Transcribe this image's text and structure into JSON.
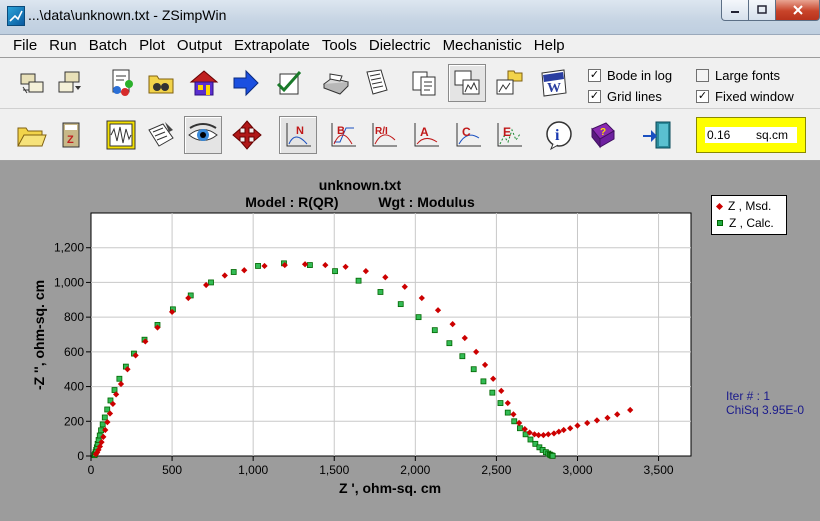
{
  "window": {
    "title": "...\\data\\unknown.txt - ZSimpWin",
    "minimize_icon": "minimize-icon",
    "maximize_icon": "maximize-icon",
    "close_icon": "close-icon"
  },
  "menu": [
    "File",
    "Run",
    "Batch",
    "Plot",
    "Output",
    "Extrapolate",
    "Tools",
    "Dielectric",
    "Mechanistic",
    "Help"
  ],
  "toolbar1": {
    "icons": [
      "open-batch-icon",
      "save-batch-icon",
      "circuit-elements-icon",
      "find-folder-icon",
      "home-icon",
      "next-arrow-icon",
      "checklist-icon",
      "print-icon",
      "report-icon",
      "copy-pages-icon",
      "copy-graph-icon",
      "open-graph-folder-icon",
      "word-export-icon"
    ],
    "checkboxes": [
      {
        "label": "Bode in log",
        "checked": true
      },
      {
        "label": "Grid lines",
        "checked": true
      },
      {
        "label": "Large fonts",
        "checked": false
      },
      {
        "label": "Fixed window",
        "checked": true
      }
    ]
  },
  "toolbar2": {
    "icons": [
      "open-file-icon",
      "calculator-icon",
      "impedance-wave-icon",
      "edit-data-icon",
      "view-eye-icon",
      "move-arrows-icon",
      "nyquist-plot-icon",
      "bode-plot-icon",
      "r-i-plot-icon",
      "admittance-plot-icon",
      "capacitance-plot-icon",
      "modulus-plot-icon",
      "info-icon",
      "help-book-icon",
      "exit-door-icon"
    ],
    "plot_letters": [
      "N",
      "B",
      "R/I",
      "A",
      "C",
      "E"
    ],
    "area_value": "0.16",
    "area_unit": "sq.cm"
  },
  "chart_data": {
    "type": "scatter",
    "title": "unknown.txt",
    "subtitle_model": "Model : R(QR)",
    "subtitle_weight": "Wgt : Modulus",
    "xlabel": "Z ', ohm-sq. cm",
    "ylabel": "-Z '', ohm-sq. cm",
    "xlim": [
      0,
      3700
    ],
    "ylim": [
      0,
      1400
    ],
    "xticks": [
      0,
      500,
      1000,
      1500,
      2000,
      2500,
      3000,
      3500
    ],
    "xtick_labels": [
      "0",
      "500",
      "1,000",
      "1,500",
      "2,000",
      "2,500",
      "3,000",
      "3,500"
    ],
    "yticks": [
      0,
      200,
      400,
      600,
      800,
      1000,
      1200
    ],
    "ytick_labels": [
      "0",
      "200",
      "400",
      "600",
      "800",
      "1,000",
      "1,200"
    ],
    "grid": true,
    "legend_position": "top-right, outside plot",
    "series": [
      {
        "name": "Z ,  Msd.",
        "color": "#cc0000",
        "marker": "diamond",
        "x": [
          30,
          38,
          46,
          55,
          65,
          76,
          88,
          101,
          117,
          135,
          155,
          185,
          225,
          275,
          335,
          410,
          500,
          600,
          710,
          825,
          945,
          1070,
          1195,
          1320,
          1445,
          1570,
          1695,
          1815,
          1935,
          2040,
          2140,
          2230,
          2305,
          2375,
          2430,
          2480,
          2530,
          2570,
          2605,
          2640,
          2675,
          2705,
          2735,
          2760,
          2790,
          2820,
          2855,
          2885,
          2915,
          2955,
          3000,
          3060,
          3120,
          3185,
          3245,
          3325
        ],
        "y": [
          10,
          20,
          35,
          55,
          80,
          110,
          150,
          195,
          245,
          300,
          355,
          415,
          500,
          580,
          660,
          740,
          830,
          910,
          985,
          1040,
          1070,
          1095,
          1100,
          1105,
          1100,
          1090,
          1065,
          1030,
          975,
          910,
          840,
          760,
          680,
          600,
          525,
          445,
          375,
          305,
          240,
          190,
          155,
          135,
          125,
          120,
          120,
          125,
          130,
          140,
          150,
          160,
          175,
          190,
          205,
          220,
          240,
          265
        ]
      },
      {
        "name": "Z ,  Calc.",
        "color": "#009900",
        "marker": "square",
        "x": [
          22,
          25,
          28,
          32,
          36,
          41,
          47,
          54,
          62,
          72,
          85,
          100,
          120,
          145,
          175,
          215,
          265,
          330,
          410,
          505,
          615,
          740,
          880,
          1030,
          1190,
          1350,
          1505,
          1650,
          1785,
          1910,
          2020,
          2120,
          2210,
          2290,
          2360,
          2420,
          2475,
          2525,
          2570,
          2610,
          2645,
          2680,
          2710,
          2740,
          2765,
          2785,
          2805,
          2820,
          2830,
          2838,
          2843,
          2847
        ],
        "y": [
          5,
          12,
          22,
          35,
          50,
          70,
          92,
          118,
          148,
          182,
          222,
          268,
          320,
          380,
          445,
          515,
          590,
          670,
          755,
          845,
          925,
          1000,
          1060,
          1095,
          1110,
          1100,
          1065,
          1010,
          945,
          875,
          800,
          725,
          650,
          575,
          500,
          430,
          365,
          305,
          250,
          200,
          160,
          125,
          95,
          70,
          50,
          35,
          22,
          14,
          8,
          4,
          2,
          1
        ]
      }
    ]
  },
  "status": {
    "iter_label": "Iter # :  1",
    "chisq_label": "ChiSq  3.95E-0"
  }
}
